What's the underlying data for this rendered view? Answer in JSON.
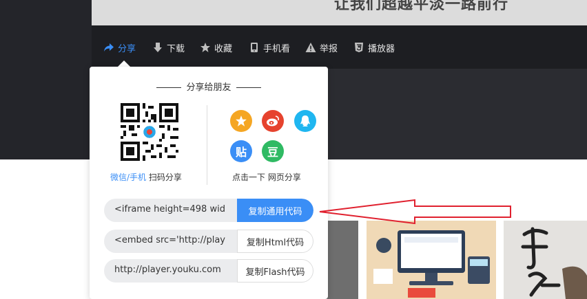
{
  "video": {
    "overlay_text": "让我们超越平淡一路前行"
  },
  "toolbar": {
    "items": [
      {
        "label": "分享",
        "icon": "share-icon",
        "active": true
      },
      {
        "label": "下载",
        "icon": "download-icon"
      },
      {
        "label": "收藏",
        "icon": "star-icon"
      },
      {
        "label": "手机看",
        "icon": "mobile-icon"
      },
      {
        "label": "举报",
        "icon": "warning-icon"
      },
      {
        "label": "播放器",
        "icon": "html5-icon"
      }
    ]
  },
  "share_popup": {
    "title": "分享给朋友",
    "qr_caption_link": "微信/手机",
    "qr_caption_text": " 扫码分享",
    "web_caption": "点击一下 网页分享",
    "social_icons": [
      {
        "name": "qzone-icon",
        "color": "#f5a623",
        "glyph": "★"
      },
      {
        "name": "weibo-icon",
        "color": "#e6432e",
        "glyph": "微"
      },
      {
        "name": "qq-icon",
        "color": "#1fb6f0",
        "glyph": "Q"
      },
      {
        "name": "tieba-icon",
        "color": "#3a8ef6",
        "glyph": "贴"
      },
      {
        "name": "douban-icon",
        "color": "#2fba63",
        "glyph": "豆"
      }
    ],
    "code_rows": [
      {
        "value": "<iframe height=498 wid",
        "button": "复制通用代码",
        "primary": true
      },
      {
        "value": "<embed src='http://play",
        "button": "复制Html代码",
        "primary": false
      },
      {
        "value": "http://player.youku.com",
        "button": "复制Flash代码",
        "primary": false
      }
    ]
  },
  "colors": {
    "accent": "#3a8ef6",
    "toolbar_bg": "#1d1e22",
    "arrow": "#e0202e"
  }
}
